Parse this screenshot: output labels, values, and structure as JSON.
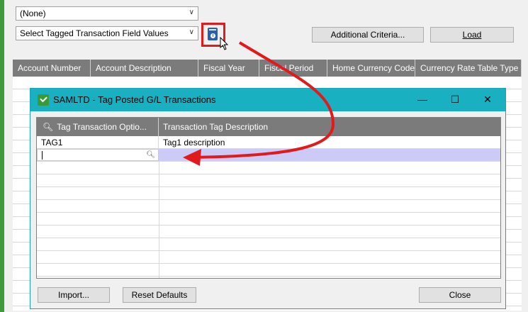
{
  "main": {
    "filter_combo_value": "(None)",
    "tagged_combo_value": "Select Tagged Transaction Field Values",
    "additional_criteria_label": "Additional Criteria...",
    "load_label": "Load",
    "columns": [
      "Account Number",
      "Account Description",
      "Fiscal Year",
      "Fiscal Period",
      "Home Currency Code",
      "Currency Rate Table Type"
    ]
  },
  "dialog": {
    "title": "SAMLTD - Tag Posted G/L Transactions",
    "minimize_glyph": "—",
    "maximize_glyph": "☐",
    "close_glyph": "✕",
    "columns": [
      "Tag Transaction Optio...",
      "Transaction Tag Description"
    ],
    "rows": [
      {
        "option": "TAG1",
        "description": "Tag1 description"
      }
    ],
    "import_label": "Import...",
    "reset_label": "Reset Defaults",
    "close_label": "Close"
  },
  "annotation": {
    "arrow_color": "#e11b1b",
    "box_color": "#e11b1b"
  }
}
